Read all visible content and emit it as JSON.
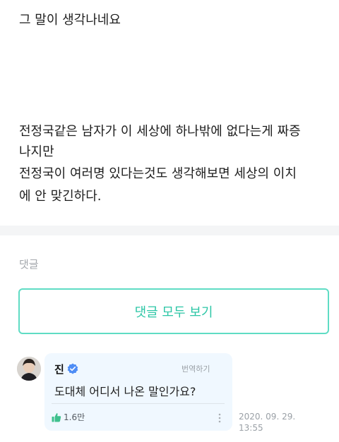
{
  "post": {
    "lines": [
      "그 말이 생각나네요",
      "전정국같은 남자가 이 세상에 하나밖에 없다는게 짜증",
      "나지만",
      "전정국이 여러명 있다는것도 생각해보면 세상의 이치",
      "에 안 맞긴하다."
    ]
  },
  "comments": {
    "section_label": "댓글",
    "view_all_label": "댓글 모두 보기",
    "items": [
      {
        "author": "진",
        "verified": true,
        "translate_label": "번역하기",
        "text": "도대체 어디서 나온 말인가요?",
        "likes": "1.6만",
        "timestamp_date": "2020. 09. 29.",
        "timestamp_time": "13:55"
      }
    ]
  },
  "colors": {
    "accent": "#2cc6a6",
    "accent_border": "#5fdcc4",
    "bubble_bg": "#f0f8ff",
    "divider_band": "#f4f5f6",
    "muted_text": "#a4a8ad",
    "like_icon": "#3ec08d",
    "verified_badge": "#4e8df5"
  },
  "icons": {
    "verified": "verified-badge-icon",
    "like": "thumbs-up-icon",
    "more": "more-vertical-icon"
  }
}
